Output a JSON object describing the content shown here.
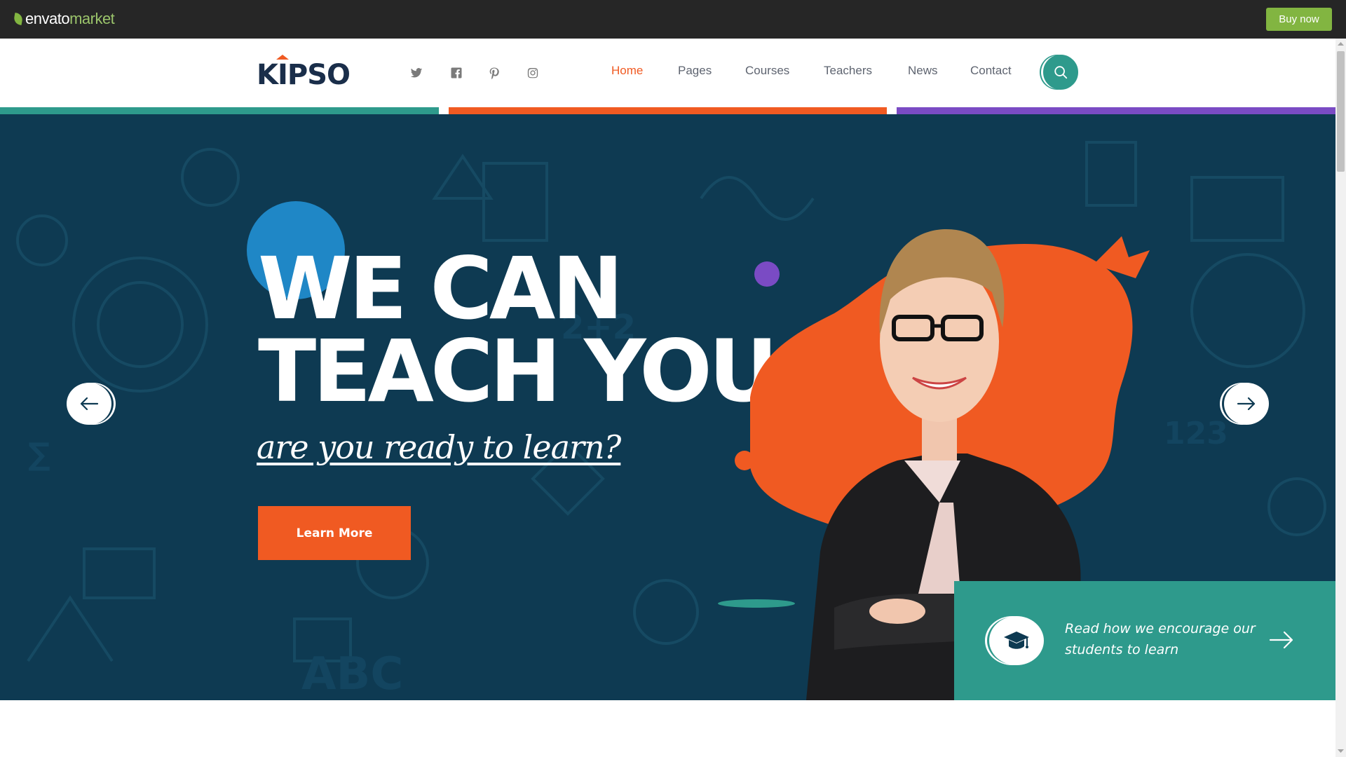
{
  "envato": {
    "logo_envato": "envato",
    "logo_market": "market",
    "buy_now": "Buy now"
  },
  "header": {
    "brand": "KIPSO",
    "social_icons": [
      "twitter-icon",
      "facebook-icon",
      "pinterest-icon",
      "instagram-icon"
    ],
    "nav": [
      {
        "label": "Home",
        "active": true
      },
      {
        "label": "Pages",
        "active": false
      },
      {
        "label": "Courses",
        "active": false
      },
      {
        "label": "Teachers",
        "active": false
      },
      {
        "label": "News",
        "active": false
      },
      {
        "label": "Contact",
        "active": false
      }
    ],
    "search_icon": "search-icon"
  },
  "strip_colors": [
    "#2e9a8c",
    "#f05a22",
    "#7a4bc4"
  ],
  "hero": {
    "headline_line1": "WE CAN",
    "headline_line2": "TEACH YOU",
    "tagline": "are you ready to learn?",
    "cta": "Learn More",
    "prev_icon": "arrow-left-icon",
    "next_icon": "arrow-right-icon",
    "info": {
      "text": "Read how we encourage our students to learn",
      "icon": "graduation-cap-icon",
      "arrow_icon": "arrow-right-icon"
    }
  },
  "colors": {
    "accent_orange": "#f05a22",
    "teal": "#2e9a8c",
    "purple": "#7a4bc4",
    "hero_bg": "#0e3a52",
    "envato_green": "#82b541"
  }
}
